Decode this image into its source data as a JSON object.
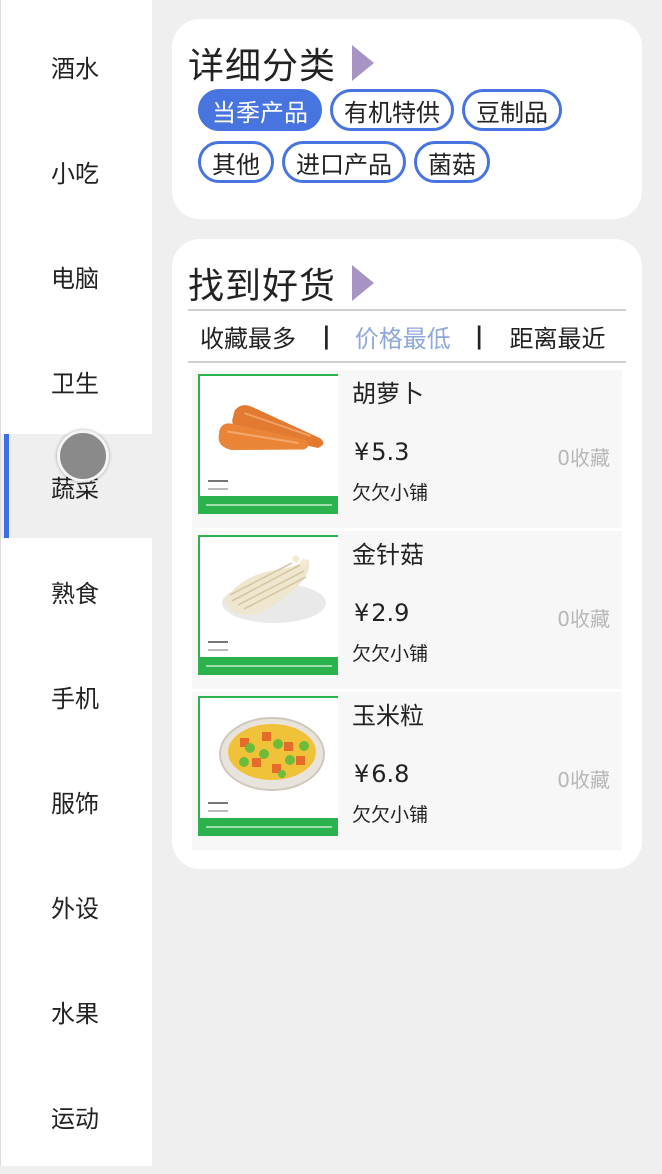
{
  "sidebar": {
    "items": [
      {
        "label": "酒水"
      },
      {
        "label": "小吃"
      },
      {
        "label": "电脑"
      },
      {
        "label": "卫生"
      },
      {
        "label": "蔬菜"
      },
      {
        "label": "熟食"
      },
      {
        "label": "手机"
      },
      {
        "label": "服饰"
      },
      {
        "label": "外设"
      },
      {
        "label": "水果"
      },
      {
        "label": "运动"
      }
    ],
    "active_index": 4
  },
  "category_card": {
    "title": "详细分类",
    "chips": [
      {
        "label": "当季产品",
        "active": true
      },
      {
        "label": "有机特供",
        "active": false
      },
      {
        "label": "豆制品",
        "active": false
      },
      {
        "label": "其他",
        "active": false
      },
      {
        "label": "进口产品",
        "active": false
      },
      {
        "label": "菌菇",
        "active": false
      }
    ]
  },
  "goods_card": {
    "title": "找到好货",
    "sort_options": [
      {
        "label": "收藏最多",
        "active": false
      },
      {
        "label": "价格最低",
        "active": true
      },
      {
        "label": "距离最近",
        "active": false
      }
    ],
    "separator": "|",
    "products": [
      {
        "name": "胡萝卜",
        "currency": "¥",
        "price": "5.3",
        "collect": "0收藏",
        "shop": "欠欠小铺",
        "image_icon": "carrot-image"
      },
      {
        "name": "金针菇",
        "currency": "¥",
        "price": "2.9",
        "collect": "0收藏",
        "shop": "欠欠小铺",
        "image_icon": "enoki-mushroom-image"
      },
      {
        "name": "玉米粒",
        "currency": "¥",
        "price": "6.8",
        "collect": "0收藏",
        "shop": "欠欠小铺",
        "image_icon": "mixed-vegetables-image"
      }
    ]
  },
  "colors": {
    "accent": "#4874e0",
    "indicator": "#3f6fe4",
    "title_arrow": "#a794c4",
    "sort_active": "#8fa8dc",
    "thumb_band": "#2bb24c",
    "background": "#efefef"
  }
}
